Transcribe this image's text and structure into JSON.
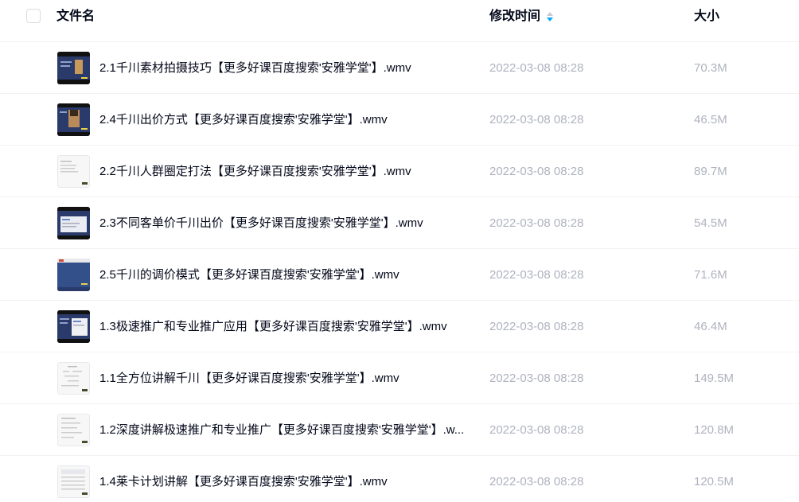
{
  "header": {
    "name_label": "文件名",
    "time_label": "修改时间",
    "size_label": "大小",
    "sort_icon": "sort-arrows-icon"
  },
  "files": [
    {
      "name": "2.1千川素材拍摄技巧【更多好课百度搜索'安雅学堂'】.wmv",
      "time": "2022-03-08 08:28",
      "size": "70.3M",
      "thumb": "dark-video-thumbnail"
    },
    {
      "name": "2.4千川出价方式【更多好课百度搜索'安雅学堂'】.wmv",
      "time": "2022-03-08 08:28",
      "size": "46.5M",
      "thumb": "dark-video-thumbnail"
    },
    {
      "name": "2.2千川人群圈定打法【更多好课百度搜索'安雅学堂'】.wmv",
      "time": "2022-03-08 08:28",
      "size": "89.7M",
      "thumb": "light-video-thumbnail"
    },
    {
      "name": "2.3不同客单价千川出价【更多好课百度搜索'安雅学堂'】.wmv",
      "time": "2022-03-08 08:28",
      "size": "54.5M",
      "thumb": "dark-video-thumbnail"
    },
    {
      "name": "2.5千川的调价模式【更多好课百度搜索'安雅学堂'】.wmv",
      "time": "2022-03-08 08:28",
      "size": "71.6M",
      "thumb": "dark-video-thumbnail"
    },
    {
      "name": "1.3极速推广和专业推广应用【更多好课百度搜索'安雅学堂'】.wmv",
      "time": "2022-03-08 08:28",
      "size": "46.4M",
      "thumb": "dark-video-thumbnail"
    },
    {
      "name": "1.1全方位讲解千川【更多好课百度搜索'安雅学堂'】.wmv",
      "time": "2022-03-08 08:28",
      "size": "149.5M",
      "thumb": "light-video-thumbnail"
    },
    {
      "name": "1.2深度讲解极速推广和专业推广【更多好课百度搜索'安雅学堂'】.w...",
      "time": "2022-03-08 08:28",
      "size": "120.8M",
      "thumb": "light-video-thumbnail"
    },
    {
      "name": "1.4莱卡计划讲解【更多好课百度搜索'安雅学堂'】.wmv",
      "time": "2022-03-08 08:28",
      "size": "120.5M",
      "thumb": "light-video-thumbnail"
    }
  ],
  "colors": {
    "text_primary": "#03081a",
    "text_secondary": "#afb3bf",
    "sort_accent": "#06a7ff",
    "divider": "#f1f2f4"
  }
}
